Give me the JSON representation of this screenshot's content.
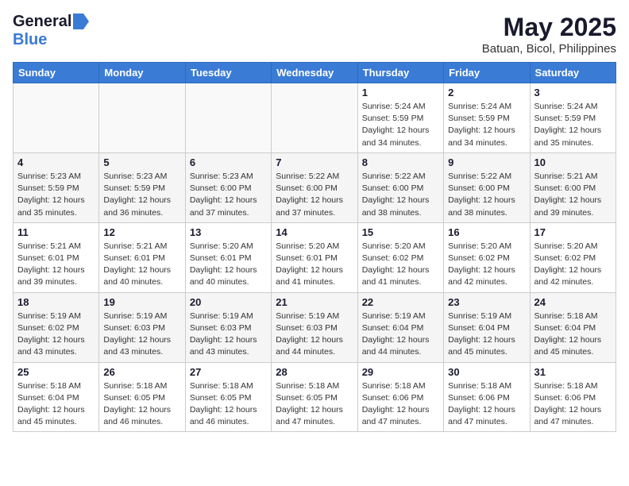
{
  "logo": {
    "general": "General",
    "blue": "Blue"
  },
  "title": "May 2025",
  "subtitle": "Batuan, Bicol, Philippines",
  "days_of_week": [
    "Sunday",
    "Monday",
    "Tuesday",
    "Wednesday",
    "Thursday",
    "Friday",
    "Saturday"
  ],
  "weeks": [
    [
      {
        "day": "",
        "info": ""
      },
      {
        "day": "",
        "info": ""
      },
      {
        "day": "",
        "info": ""
      },
      {
        "day": "",
        "info": ""
      },
      {
        "day": "1",
        "info": "Sunrise: 5:24 AM\nSunset: 5:59 PM\nDaylight: 12 hours\nand 34 minutes."
      },
      {
        "day": "2",
        "info": "Sunrise: 5:24 AM\nSunset: 5:59 PM\nDaylight: 12 hours\nand 34 minutes."
      },
      {
        "day": "3",
        "info": "Sunrise: 5:24 AM\nSunset: 5:59 PM\nDaylight: 12 hours\nand 35 minutes."
      }
    ],
    [
      {
        "day": "4",
        "info": "Sunrise: 5:23 AM\nSunset: 5:59 PM\nDaylight: 12 hours\nand 35 minutes."
      },
      {
        "day": "5",
        "info": "Sunrise: 5:23 AM\nSunset: 5:59 PM\nDaylight: 12 hours\nand 36 minutes."
      },
      {
        "day": "6",
        "info": "Sunrise: 5:23 AM\nSunset: 6:00 PM\nDaylight: 12 hours\nand 37 minutes."
      },
      {
        "day": "7",
        "info": "Sunrise: 5:22 AM\nSunset: 6:00 PM\nDaylight: 12 hours\nand 37 minutes."
      },
      {
        "day": "8",
        "info": "Sunrise: 5:22 AM\nSunset: 6:00 PM\nDaylight: 12 hours\nand 38 minutes."
      },
      {
        "day": "9",
        "info": "Sunrise: 5:22 AM\nSunset: 6:00 PM\nDaylight: 12 hours\nand 38 minutes."
      },
      {
        "day": "10",
        "info": "Sunrise: 5:21 AM\nSunset: 6:00 PM\nDaylight: 12 hours\nand 39 minutes."
      }
    ],
    [
      {
        "day": "11",
        "info": "Sunrise: 5:21 AM\nSunset: 6:01 PM\nDaylight: 12 hours\nand 39 minutes."
      },
      {
        "day": "12",
        "info": "Sunrise: 5:21 AM\nSunset: 6:01 PM\nDaylight: 12 hours\nand 40 minutes."
      },
      {
        "day": "13",
        "info": "Sunrise: 5:20 AM\nSunset: 6:01 PM\nDaylight: 12 hours\nand 40 minutes."
      },
      {
        "day": "14",
        "info": "Sunrise: 5:20 AM\nSunset: 6:01 PM\nDaylight: 12 hours\nand 41 minutes."
      },
      {
        "day": "15",
        "info": "Sunrise: 5:20 AM\nSunset: 6:02 PM\nDaylight: 12 hours\nand 41 minutes."
      },
      {
        "day": "16",
        "info": "Sunrise: 5:20 AM\nSunset: 6:02 PM\nDaylight: 12 hours\nand 42 minutes."
      },
      {
        "day": "17",
        "info": "Sunrise: 5:20 AM\nSunset: 6:02 PM\nDaylight: 12 hours\nand 42 minutes."
      }
    ],
    [
      {
        "day": "18",
        "info": "Sunrise: 5:19 AM\nSunset: 6:02 PM\nDaylight: 12 hours\nand 43 minutes."
      },
      {
        "day": "19",
        "info": "Sunrise: 5:19 AM\nSunset: 6:03 PM\nDaylight: 12 hours\nand 43 minutes."
      },
      {
        "day": "20",
        "info": "Sunrise: 5:19 AM\nSunset: 6:03 PM\nDaylight: 12 hours\nand 43 minutes."
      },
      {
        "day": "21",
        "info": "Sunrise: 5:19 AM\nSunset: 6:03 PM\nDaylight: 12 hours\nand 44 minutes."
      },
      {
        "day": "22",
        "info": "Sunrise: 5:19 AM\nSunset: 6:04 PM\nDaylight: 12 hours\nand 44 minutes."
      },
      {
        "day": "23",
        "info": "Sunrise: 5:19 AM\nSunset: 6:04 PM\nDaylight: 12 hours\nand 45 minutes."
      },
      {
        "day": "24",
        "info": "Sunrise: 5:18 AM\nSunset: 6:04 PM\nDaylight: 12 hours\nand 45 minutes."
      }
    ],
    [
      {
        "day": "25",
        "info": "Sunrise: 5:18 AM\nSunset: 6:04 PM\nDaylight: 12 hours\nand 45 minutes."
      },
      {
        "day": "26",
        "info": "Sunrise: 5:18 AM\nSunset: 6:05 PM\nDaylight: 12 hours\nand 46 minutes."
      },
      {
        "day": "27",
        "info": "Sunrise: 5:18 AM\nSunset: 6:05 PM\nDaylight: 12 hours\nand 46 minutes."
      },
      {
        "day": "28",
        "info": "Sunrise: 5:18 AM\nSunset: 6:05 PM\nDaylight: 12 hours\nand 47 minutes."
      },
      {
        "day": "29",
        "info": "Sunrise: 5:18 AM\nSunset: 6:06 PM\nDaylight: 12 hours\nand 47 minutes."
      },
      {
        "day": "30",
        "info": "Sunrise: 5:18 AM\nSunset: 6:06 PM\nDaylight: 12 hours\nand 47 minutes."
      },
      {
        "day": "31",
        "info": "Sunrise: 5:18 AM\nSunset: 6:06 PM\nDaylight: 12 hours\nand 47 minutes."
      }
    ]
  ]
}
